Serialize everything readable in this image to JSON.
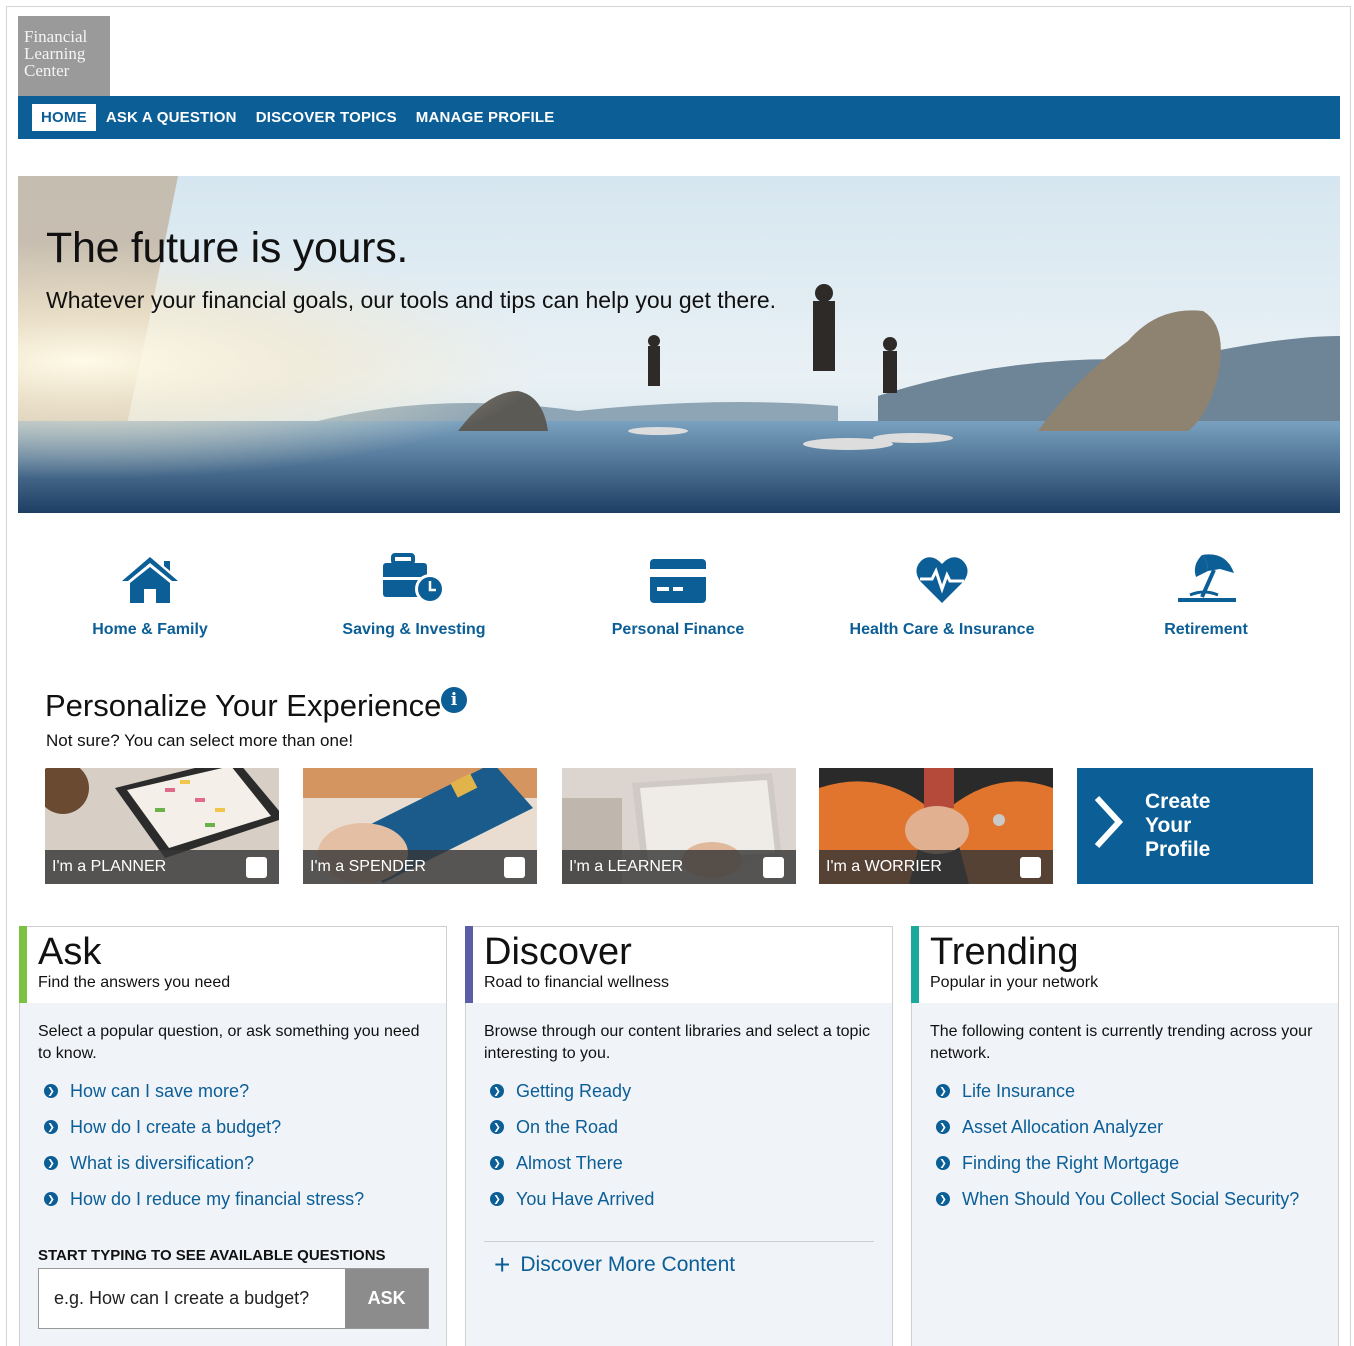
{
  "logo": {
    "line1": "Financial",
    "line2": "Learning",
    "line3": "Center"
  },
  "nav": {
    "items": [
      "HOME",
      "ASK A QUESTION",
      "DISCOVER TOPICS",
      "MANAGE PROFILE"
    ],
    "active": "HOME"
  },
  "hero": {
    "title": "The future is yours.",
    "subtitle": "Whatever your financial goals, our tools and tips can help you get there."
  },
  "topics": [
    {
      "label": "Home & Family",
      "icon": "house-icon"
    },
    {
      "label": "Saving & Investing",
      "icon": "briefcase-clock-icon"
    },
    {
      "label": "Personal Finance",
      "icon": "credit-card-icon"
    },
    {
      "label": "Health Care & Insurance",
      "icon": "heart-pulse-icon"
    },
    {
      "label": "Retirement",
      "icon": "beach-umbrella-icon"
    }
  ],
  "personalize": {
    "title": "Personalize Your Experience",
    "subtitle": "Not sure? You can select more than one!",
    "personas": [
      "I'm a PLANNER",
      "I'm a SPENDER",
      "I'm a LEARNER",
      "I'm a WORRIER"
    ],
    "create": {
      "line1": "Create",
      "line2": "Your",
      "line3": "Profile"
    }
  },
  "ask": {
    "title": "Ask",
    "subtitle": "Find the answers you need",
    "description": "Select a popular question, or ask something you need to know.",
    "links": [
      "How can I save more?",
      "How do I create a budget?",
      "What is diversification?",
      "How do I reduce my financial stress?"
    ],
    "input_label": "START TYPING TO SEE AVAILABLE QUESTIONS",
    "input_placeholder": "e.g. How can I create a budget?",
    "button": "ASK"
  },
  "discover": {
    "title": "Discover",
    "subtitle": "Road to financial wellness",
    "description": "Browse through our content libraries and select a topic interesting to you.",
    "links": [
      "Getting Ready",
      "On the Road",
      "Almost There",
      "You Have Arrived"
    ],
    "more": "Discover More Content"
  },
  "trending": {
    "title": "Trending",
    "subtitle": "Popular in your network",
    "description": "The following content is currently trending across your network.",
    "links": [
      "Life Insurance",
      "Asset Allocation Analyzer",
      "Finding the Right Mortgage",
      "When Should You Collect Social Security?"
    ]
  },
  "colors": {
    "primary": "#0b5e96",
    "ask_accent": "#7cc242",
    "discover_accent": "#5b5ea6",
    "trending_accent": "#1aa99a"
  }
}
